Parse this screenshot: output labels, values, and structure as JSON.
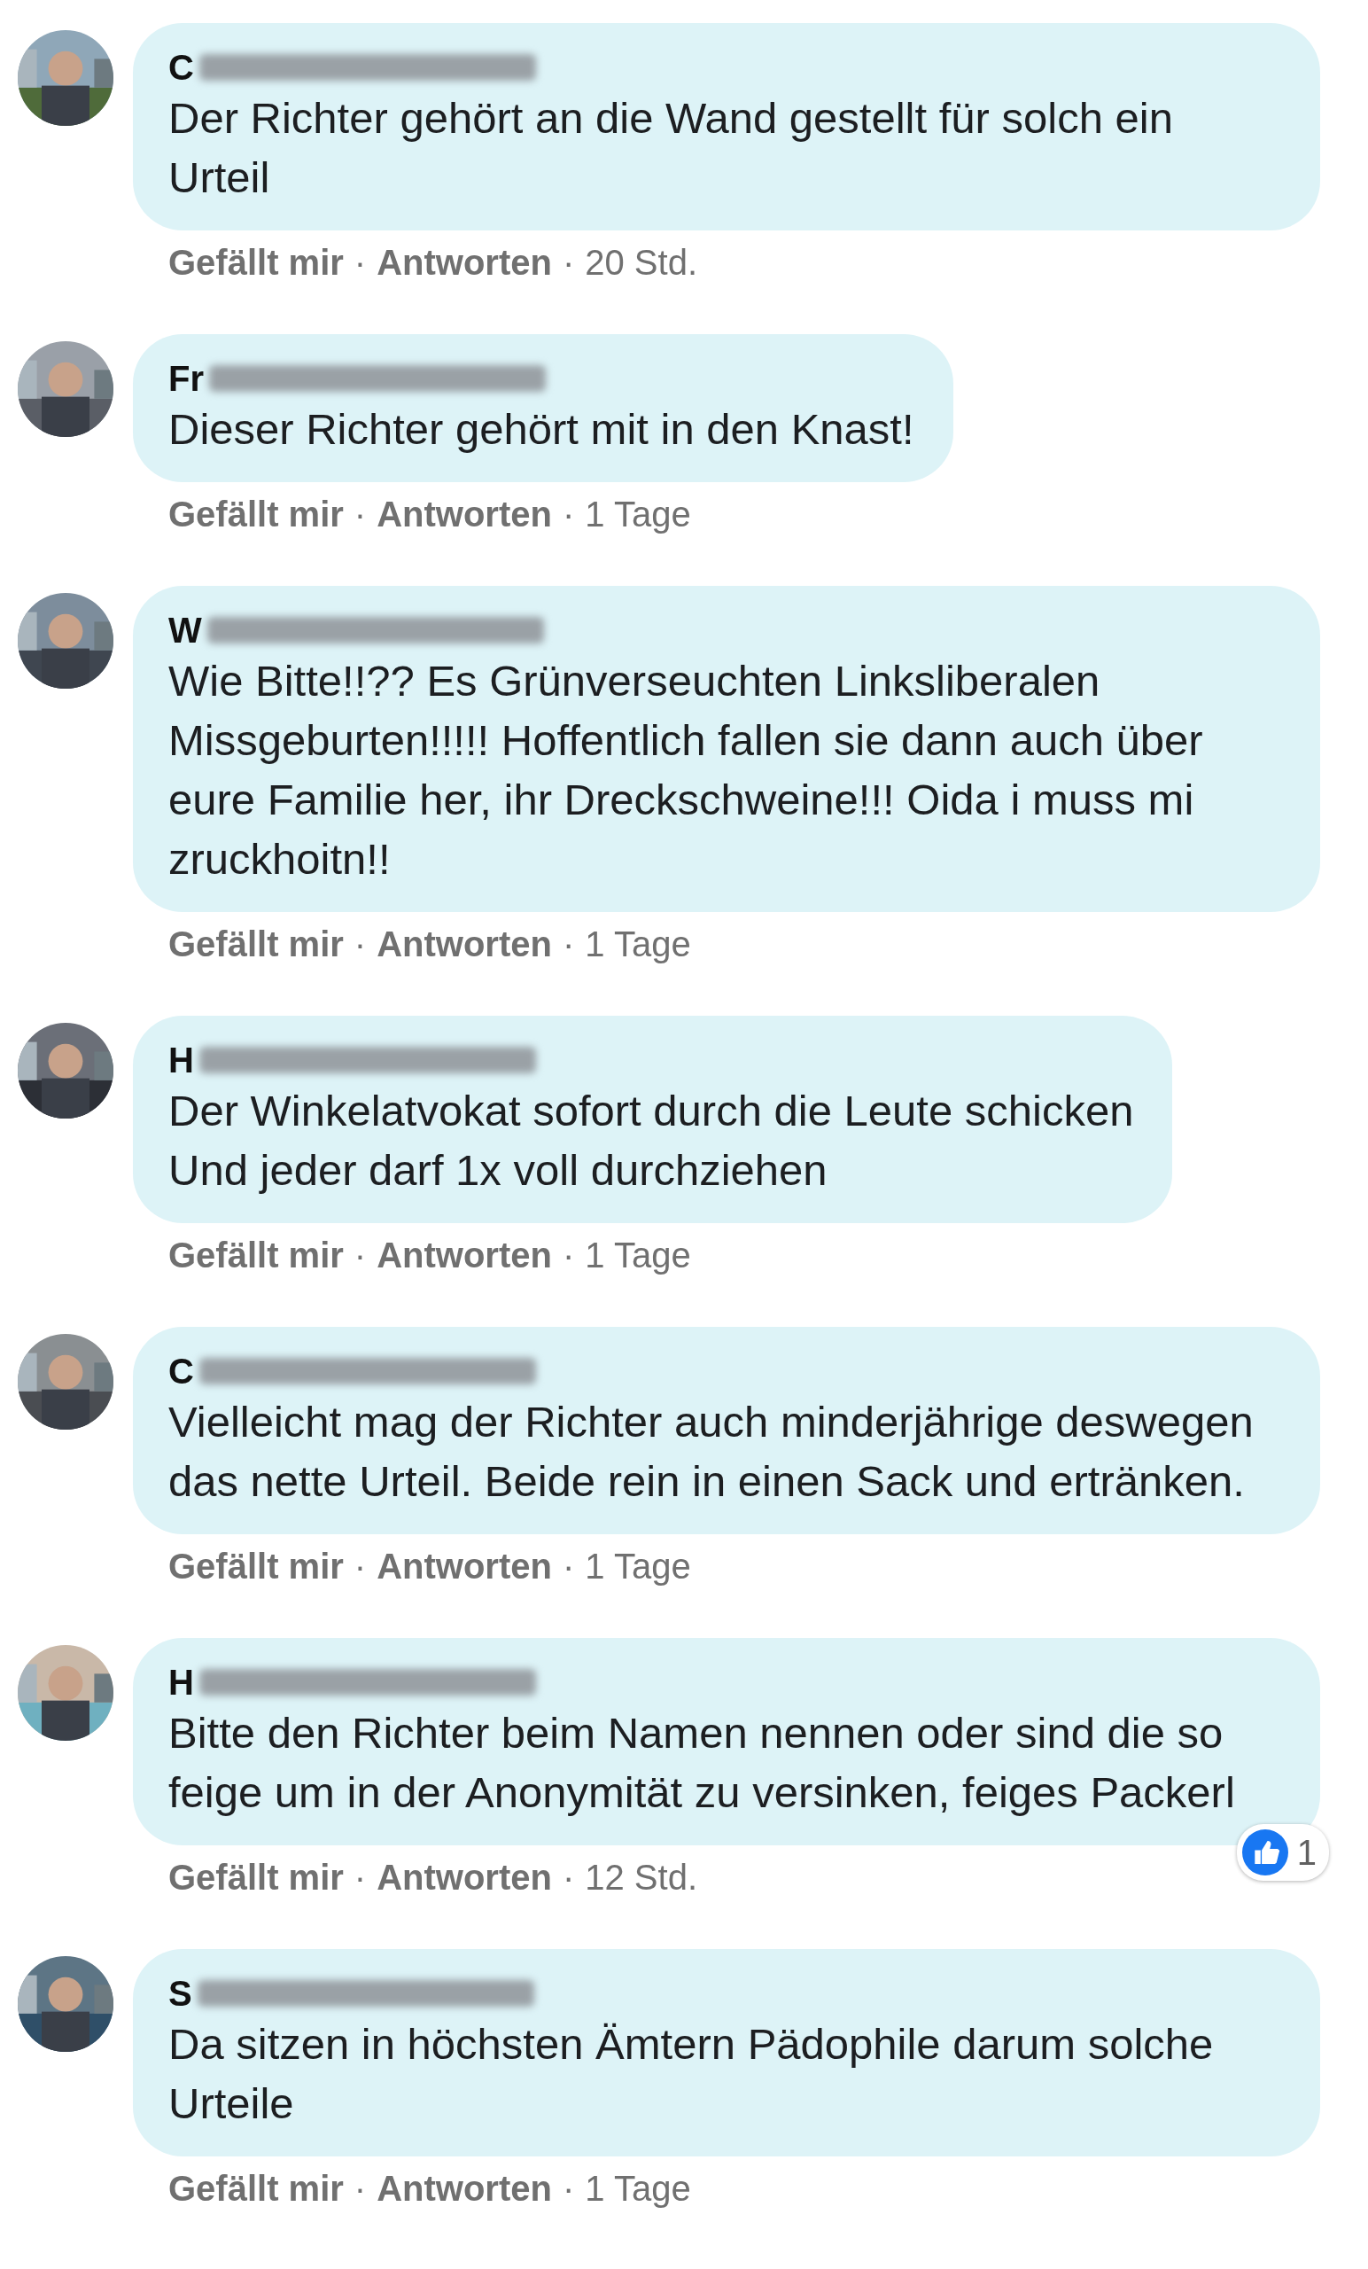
{
  "separator": "·",
  "comments": [
    {
      "author": "C",
      "text": "Der Richter gehört an die Wand gestellt für solch ein Urteil",
      "like": "Gefällt mir",
      "reply": "Antworten",
      "time": "20 Std."
    },
    {
      "author": "Fr",
      "text": "Dieser Richter gehört mit in den Knast!",
      "like": "Gefällt mir",
      "reply": "Antworten",
      "time": "1 Tage"
    },
    {
      "author": "W",
      "text": "Wie Bitte!!?? Es Grünverseuchten Linksliberalen Missgeburten!!!!! Hoffentlich fallen sie dann auch über eure Familie her, ihr Dreckschweine!!! Oida i muss mi zruckhoitn!!",
      "like": "Gefällt mir",
      "reply": "Antworten",
      "time": "1 Tage"
    },
    {
      "author": "H",
      "text": "Der Winkelatvokat sofort durch die Leute schicken\nUnd jeder darf 1x voll durchziehen",
      "like": "Gefällt mir",
      "reply": "Antworten",
      "time": "1 Tage"
    },
    {
      "author": "C",
      "text": "Vielleicht mag der Richter auch minderjährige deswegen das nette Urteil. Beide rein in einen Sack und ertränken.",
      "like": "Gefällt mir",
      "reply": "Antworten",
      "time": "1 Tage"
    },
    {
      "author": "H",
      "text": "Bitte den Richter beim Namen nennen oder sind die so feige um in der Anonymität zu versinken, feiges Packerl",
      "like": "Gefällt mir",
      "reply": "Antworten",
      "time": "12 Std.",
      "reactions": "1"
    },
    {
      "author": "S",
      "text": "Da sitzen in höchsten Ämtern Pädophile darum solche Urteile",
      "like": "Gefällt mir",
      "reply": "Antworten",
      "time": "1 Tage"
    }
  ]
}
